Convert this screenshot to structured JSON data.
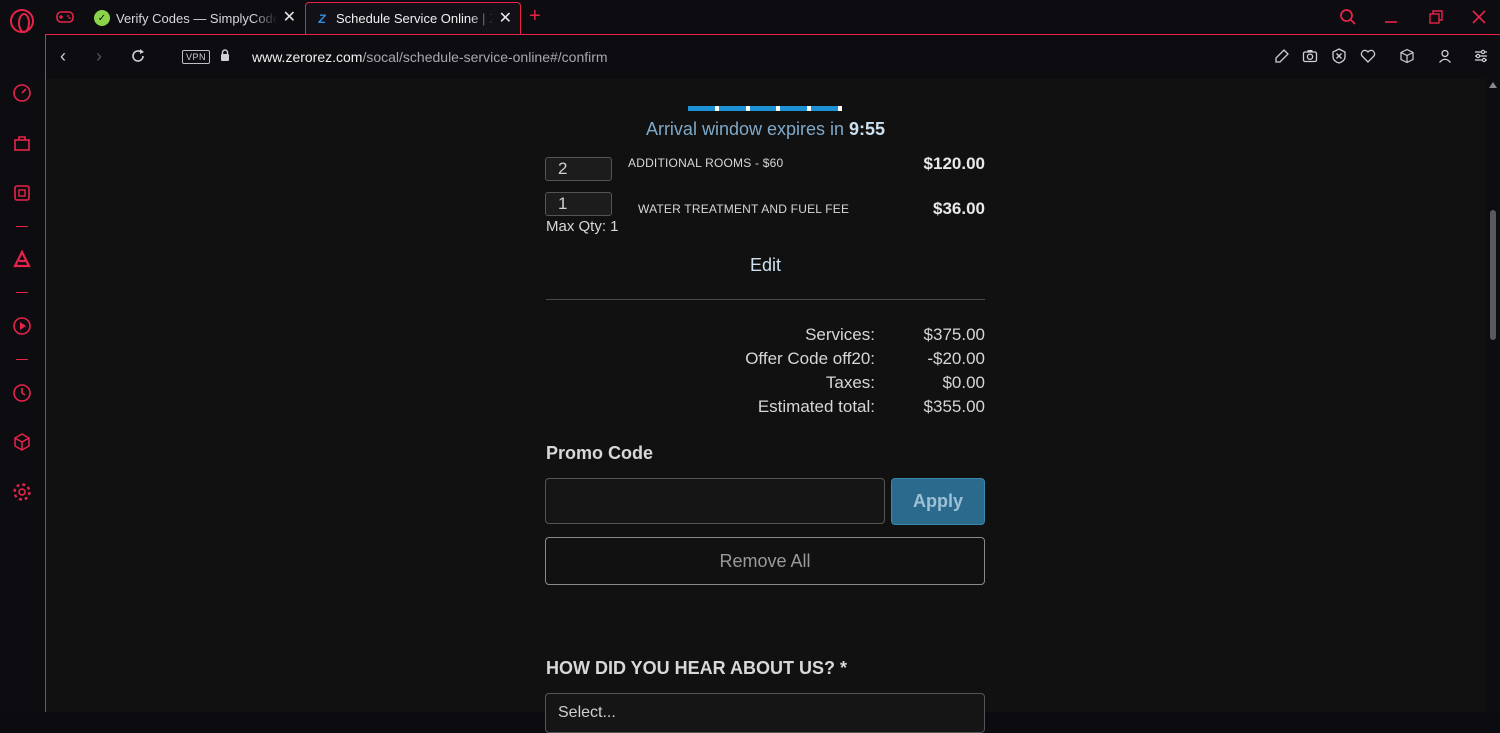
{
  "browser": {
    "tabs": [
      {
        "title": "Verify Codes — SimplyCodes",
        "active": false
      },
      {
        "title": "Schedule Service Online | Zerorez",
        "active": true
      }
    ],
    "new_tab": "+",
    "url_domain": "www.zerorez.com",
    "url_path": "/socal/schedule-service-online#/confirm",
    "vpn_label": "VPN",
    "accent_color": "#e8234a"
  },
  "timer": {
    "prefix": "Arrival window expires in",
    "time": "9:55"
  },
  "line_items": [
    {
      "qty": "2",
      "label": "ADDITIONAL ROOMS - $60",
      "price": "$120.00"
    },
    {
      "qty": "1",
      "label": "WATER TREATMENT AND FUEL FEE",
      "price": "$36.00",
      "note": "Max Qty: 1"
    }
  ],
  "edit_label": "Edit",
  "summary": [
    {
      "label": "Services:",
      "value": "$375.00"
    },
    {
      "label": "Offer Code off20:",
      "value": "-$20.00"
    },
    {
      "label": "Taxes:",
      "value": "$0.00"
    },
    {
      "label": "Estimated total:",
      "value": "$355.00"
    }
  ],
  "promo": {
    "label": "Promo Code",
    "value": "",
    "apply_label": "Apply",
    "remove_all_label": "Remove All"
  },
  "hear_about": {
    "label": "HOW DID YOU HEAR ABOUT US? *",
    "selected": "Select..."
  }
}
